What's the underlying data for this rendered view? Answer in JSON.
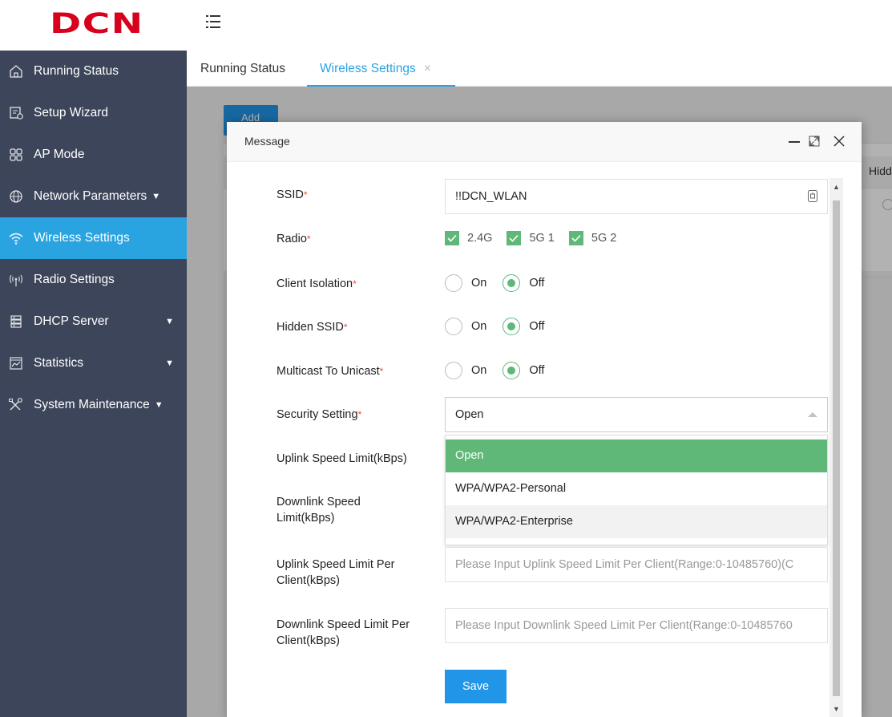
{
  "app": {
    "logo_text": "DCN",
    "logo_color": "#d7001d"
  },
  "sidebar": {
    "items": [
      {
        "label": "Running Status",
        "icon": "home-icon",
        "caret": ""
      },
      {
        "label": "Setup Wizard",
        "icon": "wizard-icon",
        "caret": ""
      },
      {
        "label": "AP Mode",
        "icon": "grid-icon",
        "caret": ""
      },
      {
        "label": "Network Parameters",
        "icon": "globe-icon",
        "caret": "▼"
      },
      {
        "label": "Wireless Settings",
        "icon": "wifi-icon",
        "caret": "",
        "active": true
      },
      {
        "label": "Radio Settings",
        "icon": "antenna-icon",
        "caret": ""
      },
      {
        "label": "DHCP Server",
        "icon": "server-icon",
        "caret": "▼"
      },
      {
        "label": "Statistics",
        "icon": "chart-icon",
        "caret": "▼"
      },
      {
        "label": "System Maintenance",
        "icon": "tools-icon",
        "caret": "▼"
      }
    ]
  },
  "tabs": {
    "running": "Running Status",
    "wireless": "Wireless Settings",
    "close_glyph": "×"
  },
  "background": {
    "add_label": "Add",
    "hidden_header": "Hidd"
  },
  "modal": {
    "title": "Message",
    "min_glyph": "—",
    "close_glyph": "✕",
    "labels": {
      "ssid": "SSID",
      "radio": "Radio",
      "client_isolation": "Client Isolation",
      "hidden_ssid": "Hidden SSID",
      "multicast": "Multicast To Unicast",
      "security": "Security Setting",
      "uplink": "Uplink Speed Limit(kBps)",
      "downlink": "Downlink Speed Limit(kBps)",
      "uplink_per_client": "Uplink Speed Limit Per Client(kBps)",
      "downlink_per_client": "Downlink Speed Limit Per Client(kBps)"
    },
    "required_mark": "*",
    "ssid_value": "!!DCN_WLAN",
    "radio_options": [
      "2.4G",
      "5G 1",
      "5G 2"
    ],
    "on_label": "On",
    "off_label": "Off",
    "security_value": "Open",
    "security_options": [
      "Open",
      "WPA/WPA2-Personal",
      "WPA/WPA2-Enterprise"
    ],
    "uplink_per_client_placeholder": "Please Input Uplink Speed Limit Per Client(Range:0-10485760)(C",
    "downlink_per_client_placeholder": "Please Input Downlink Speed Limit Per Client(Range:0-10485760",
    "save_label": "Save"
  },
  "colors": {
    "sidebar_bg": "#3c4559",
    "accent": "#2aa3e1",
    "green": "#5fb878",
    "button_blue": "#2196e8"
  }
}
